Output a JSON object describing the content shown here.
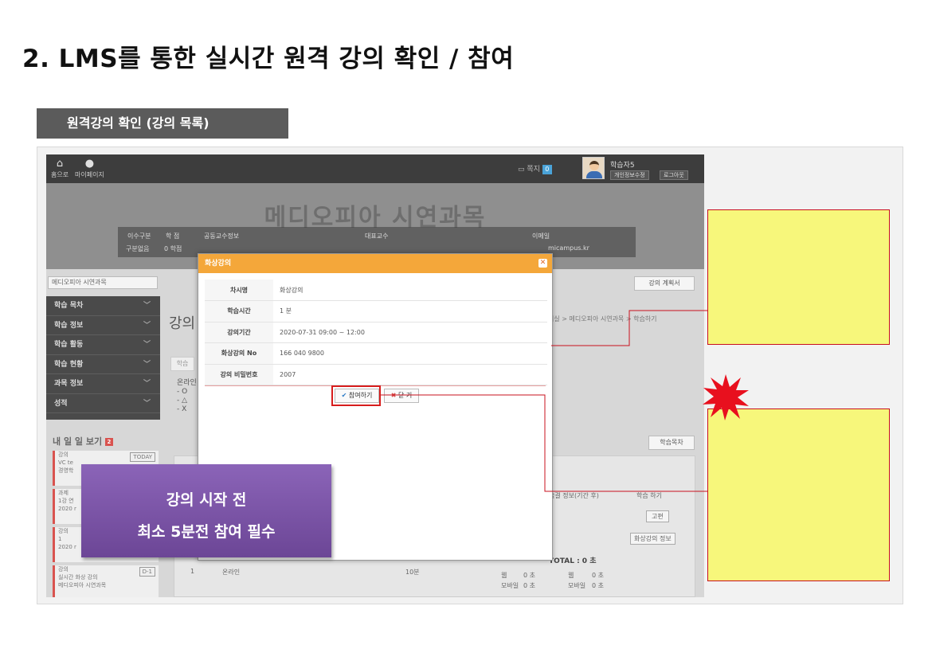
{
  "slide": {
    "title": "2. LMS를 통한 실시간 원격 강의 확인 / 참여",
    "section_tab": "원격강의 확인 (강의 목록)"
  },
  "lms": {
    "topbar": {
      "home_label": "홈으로",
      "mypage_label": "마이페이지",
      "notice_label": "쪽지",
      "notice_badge": "0",
      "username": "학습자5",
      "personal_info_btn": "개인정보수정",
      "logout_btn": "로그아웃"
    },
    "banner": {
      "course_title": "메디오피아 시연과목",
      "col_division": "이수구분",
      "col_credit": "학 점",
      "col_coprof": "공동교수정보",
      "val_division": "구분없음",
      "val_credit": "0 학점",
      "col_rep_prof": "대표교수",
      "col_email": "이메일",
      "email_value": "micampus.kr"
    },
    "course_select": "메디오피아 시연과목",
    "plan_button": "강의 계획서",
    "sidebar": [
      {
        "label": "학습 목차"
      },
      {
        "label": "학습 정보"
      },
      {
        "label": "학습 활동"
      },
      {
        "label": "학습 현황"
      },
      {
        "label": "과목 정보"
      },
      {
        "label": "성적"
      }
    ],
    "content_title": "강의",
    "breadcrumb": "의실 > 메디오피아 시연과목 > 학습하기",
    "tab_label": "학습",
    "legend": [
      "온라인",
      "- O",
      "- △",
      "- X"
    ],
    "calendar": {
      "title": "내 일 일 보기",
      "badge": "2",
      "entries": [
        {
          "line1": "강의",
          "line2": "VC te",
          "line3": "경영학",
          "tag": "TODAY"
        },
        {
          "line1": "과제",
          "line2": "1강 연",
          "line3": "2020 r",
          "tag": ""
        },
        {
          "line1": "강의",
          "line2": "1",
          "line3": "2020 r",
          "tag": ""
        },
        {
          "line1": "강의",
          "line2": "실시간 화상 강의",
          "line3": "메디오피아 시연과목",
          "tag": "D-1"
        }
      ]
    },
    "list_button": "학습목차",
    "table": {
      "col_attendance": "출결 정보(기간 후)",
      "col_study": "학습 하기",
      "btn_review": "고편",
      "btn_live_info": "화상강의 정보",
      "total_label": "TOTAL : 0 초",
      "row_no": "1",
      "row_type": "온라인",
      "row_duration": "10분",
      "web_label": "웹",
      "mobile_label": "모바일",
      "zero_sec": "0 초"
    }
  },
  "modal": {
    "title": "화상강의",
    "rows": [
      {
        "label": "차시명",
        "value": "화상강의"
      },
      {
        "label": "학습시간",
        "value": "1 분"
      },
      {
        "label": "강의기간",
        "value": "2020-07-31 09:00 ~ 12:00"
      },
      {
        "label": "화상강의 No",
        "value": "166 040 9800"
      },
      {
        "label": "강의 비밀번호",
        "value": "2007"
      }
    ],
    "join_button": "참여하기",
    "close_button": "닫 기"
  },
  "callout": {
    "line1": "강의 시작 전",
    "line2": "최소 5분전 참여 필수"
  },
  "colors": {
    "modal_header": "#f4a73a",
    "callout_purple": "#7b55a8",
    "note_yellow": "#f7f77b",
    "highlight_red": "#d71d1d"
  }
}
